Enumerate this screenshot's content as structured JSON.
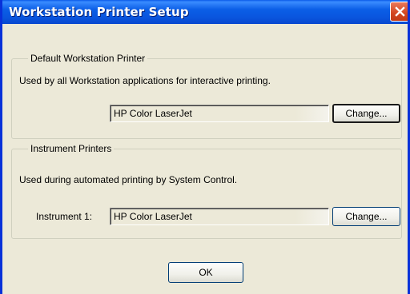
{
  "window": {
    "title": "Workstation Printer Setup"
  },
  "default_group": {
    "legend": "Default Workstation Printer",
    "description": "Used by all Workstation applications for interactive printing.",
    "printer_value": "HP Color LaserJet",
    "change_label": "Change..."
  },
  "instrument_group": {
    "legend": "Instrument Printers",
    "description": "Used during automated printing by System Control.",
    "instrument_label": "Instrument 1:",
    "printer_value": "HP Color LaserJet",
    "change_label": "Change..."
  },
  "footer": {
    "ok_label": "OK"
  },
  "icons": {
    "close": "close-icon"
  },
  "colors": {
    "titlebar": "#0a56df",
    "close_button": "#d2451f",
    "dialog_background": "#ece9d8"
  }
}
